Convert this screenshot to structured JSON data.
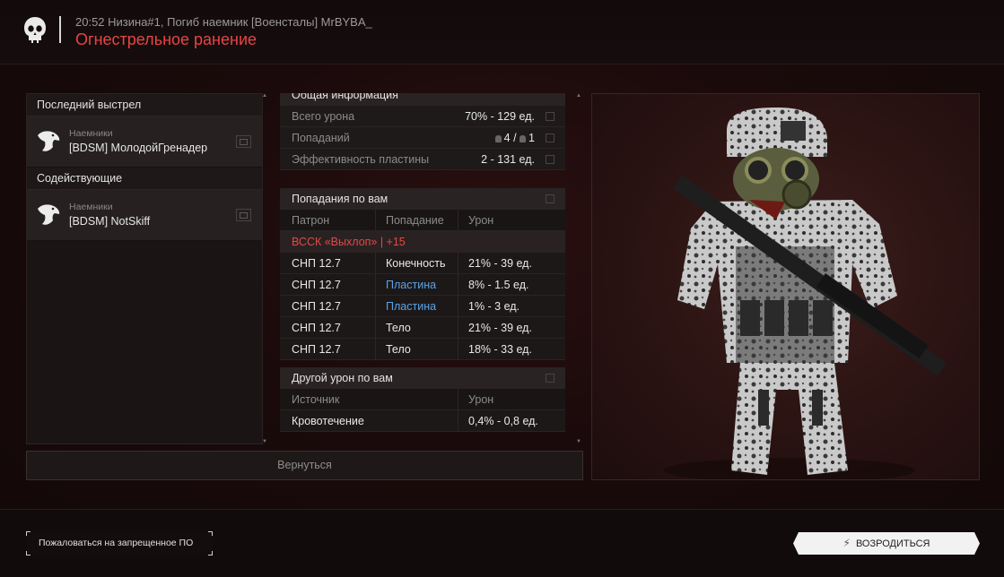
{
  "header": {
    "subline": "20:52 Низина#1, Погиб наемник [Военсталы] MrBYBA_",
    "title": "Огнестрельное ранение",
    "title_color": "#e84545",
    "icon": "skull-icon"
  },
  "left_panel": {
    "last_shot_title": "Последний выстрел",
    "last_shot": {
      "category": "Наемники",
      "name": "[BDSM] МолодойГренадер",
      "icon": "eagle-icon"
    },
    "assist_title": "Содействующие",
    "assists": [
      {
        "category": "Наемники",
        "name": "[BDSM] NotSkiff",
        "icon": "eagle-icon"
      }
    ]
  },
  "general": {
    "title": "Общая информация",
    "rows": [
      {
        "label": "Всего урона",
        "value": "70% - 129 ед."
      },
      {
        "label": "Попаданий",
        "value_a": "4",
        "separator": "/",
        "value_b": "1"
      },
      {
        "label": "Эффективность пластины",
        "value": "2 - 131 ед."
      }
    ]
  },
  "hits": {
    "title": "Попадания по вам",
    "columns": [
      "Патрон",
      "Попадание",
      "Урон"
    ],
    "group_label": "ВССК «Выхлоп» | +15",
    "group_color": "#e34848",
    "rows": [
      {
        "ammo": "СНП 12.7",
        "zone": "Конечность",
        "damage": "21% - 39 ед.",
        "zone_blue": false
      },
      {
        "ammo": "СНП 12.7",
        "zone": "Пластина",
        "damage": "8% - 1.5 ед.",
        "zone_blue": true
      },
      {
        "ammo": "СНП 12.7",
        "zone": "Пластина",
        "damage": "1% - 3 ед.",
        "zone_blue": true
      },
      {
        "ammo": "СНП 12.7",
        "zone": "Тело",
        "damage": "21% - 39 ед.",
        "zone_blue": false
      },
      {
        "ammo": "СНП 12.7",
        "zone": "Тело",
        "damage": "18% - 33 ед.",
        "zone_blue": false
      }
    ]
  },
  "other": {
    "title": "Другой урон по вам",
    "columns": [
      "Источник",
      "Урон"
    ],
    "rows": [
      {
        "source": "Кровотечение",
        "damage": "0,4% - 0,8 ед."
      }
    ]
  },
  "buttons": {
    "return": "Вернуться",
    "report": "Пожаловаться на запрещенное ПО",
    "respawn": "ВОЗРОДИТЬСЯ"
  }
}
